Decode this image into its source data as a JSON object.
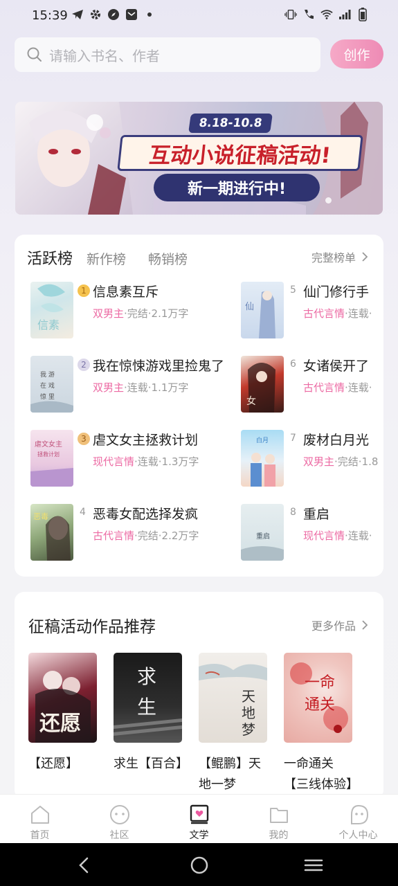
{
  "status_bar": {
    "time": "15:39"
  },
  "search": {
    "placeholder": "请输入书名、作者"
  },
  "create_button": "创作",
  "banner": {
    "date": "8.18-10.8",
    "title": "互动小说征稿活动!",
    "subtitle": "新一期进行中!"
  },
  "ranking": {
    "tabs": [
      "活跃榜",
      "新作榜",
      "畅销榜"
    ],
    "active_tab": 0,
    "full_list_label": "完整榜单",
    "books": [
      {
        "rank": "1",
        "title": "信息素互斥",
        "genre": "双男主",
        "status": "·完结·2.1万字"
      },
      {
        "rank": "2",
        "title": "我在惊悚游戏里捡鬼了",
        "genre": "双男主",
        "status": "·连载·1.1万字"
      },
      {
        "rank": "3",
        "title": "虐文女主拯救计划",
        "genre": "现代言情",
        "status": "·连载·1.3万字"
      },
      {
        "rank": "4",
        "title": "恶毒女配选择发疯",
        "genre": "古代言情",
        "status": "·完结·2.2万字"
      },
      {
        "rank": "5",
        "title": "仙门修行手",
        "genre": "古代言情",
        "status": "·连载·"
      },
      {
        "rank": "6",
        "title": "女诸侯开了",
        "genre": "古代言情",
        "status": "·连载·"
      },
      {
        "rank": "7",
        "title": "废材白月光",
        "genre": "双男主",
        "status": "·完结·1.8"
      },
      {
        "rank": "8",
        "title": "重启",
        "genre": "现代言情",
        "status": "·连载·"
      }
    ]
  },
  "recommendation": {
    "title": "征稿活动作品推荐",
    "more_label": "更多作品",
    "items": [
      {
        "name": "【还愿】",
        "cover_text": "还愿"
      },
      {
        "name": "求生【百合】",
        "cover_text": "求生"
      },
      {
        "name": "【鲲鹏】天地一梦",
        "cover_text": "天地一梦"
      },
      {
        "name": "一命通关【三线体验】",
        "cover_text": "一命通关"
      }
    ]
  },
  "bottom_nav": {
    "items": [
      "首页",
      "社区",
      "文学",
      "我的",
      "个人中心"
    ],
    "active": 2
  },
  "colors": {
    "accent": "#ec6aa3",
    "create_button": "#ee8bb5"
  }
}
